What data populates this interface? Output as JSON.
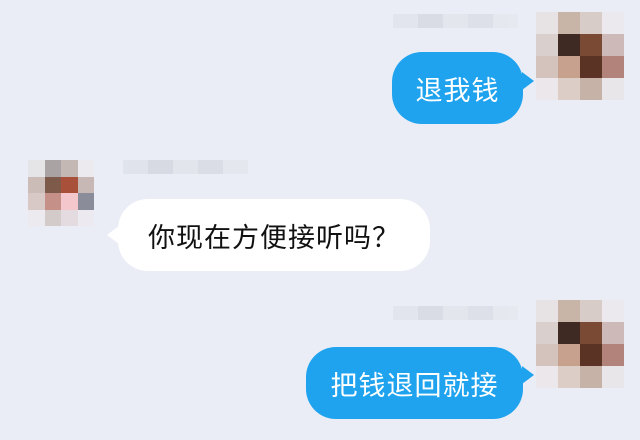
{
  "chat": {
    "messages": [
      {
        "side": "sent",
        "text": "退我钱"
      },
      {
        "side": "received",
        "text": "你现在方便接听吗？"
      },
      {
        "side": "sent",
        "text": "把钱退回就接"
      }
    ]
  },
  "colors": {
    "background": "#eaedf5",
    "sent_bubble": "#1fa3ef",
    "received_bubble": "#ffffff"
  }
}
